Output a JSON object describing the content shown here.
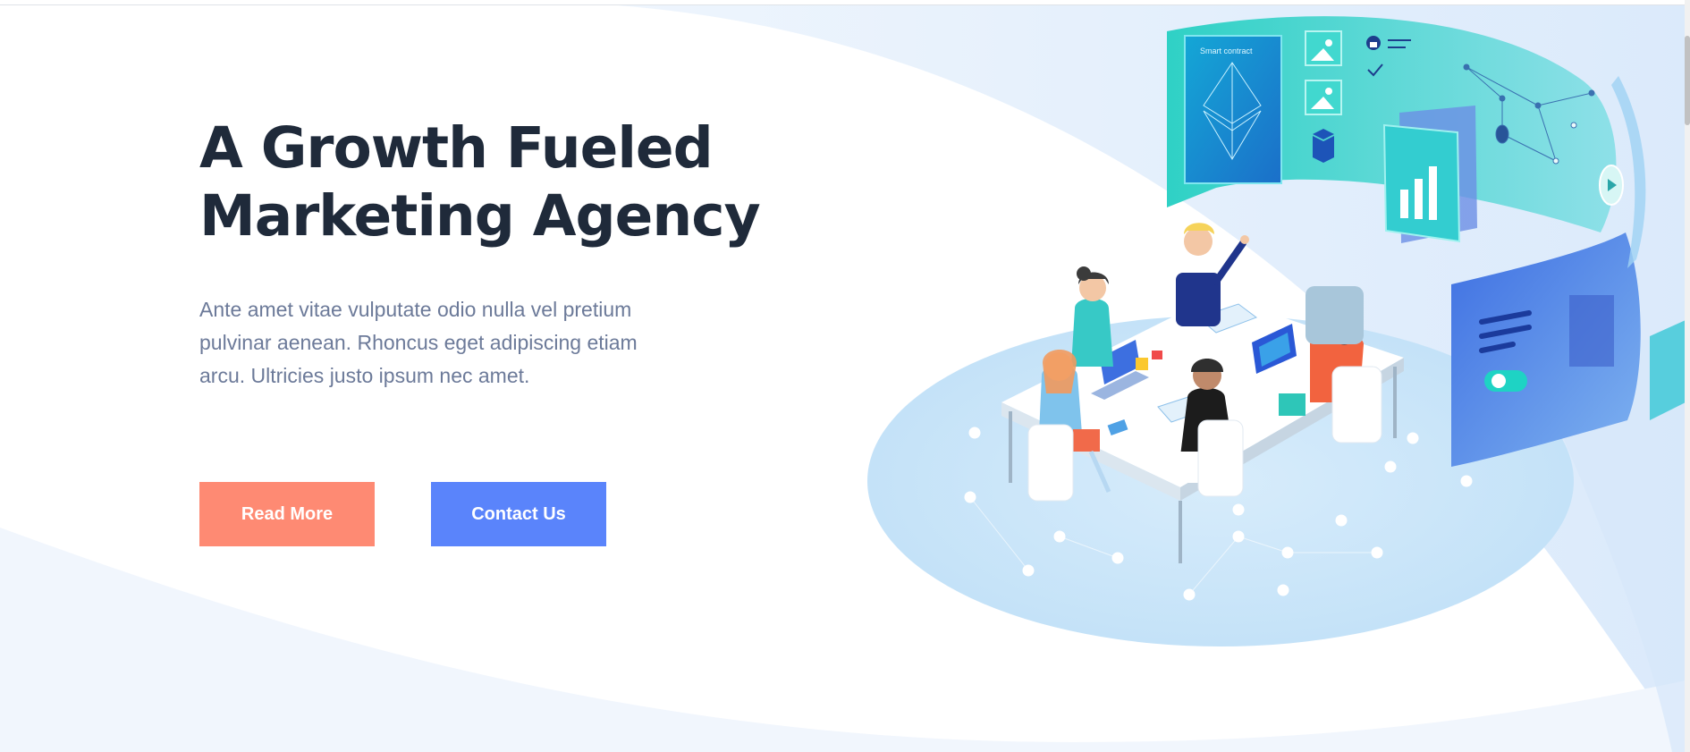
{
  "hero": {
    "title_line1": "A Growth Fueled",
    "title_line2": "Marketing Agency",
    "description_line1": "Ante amet vitae vulputate odio nulla vel pretium",
    "description_line2": "pulvinar aenean. Rhoncus eget adipiscing etiam",
    "description_line3": "arcu. Ultricies justo ipsum nec amet.",
    "read_more_label": "Read More",
    "contact_label": "Contact Us"
  },
  "illustration": {
    "panel_caption": "Smart contract",
    "icons": [
      "ethereum-icon",
      "image-icon",
      "lock-icon",
      "checkmark-icon",
      "cube-icon",
      "bar-chart-icon",
      "play-icon"
    ]
  },
  "colors": {
    "heading": "#1f2a3a",
    "body_text": "#6c7a99",
    "read_more_button": "#fe8a73",
    "contact_button": "#5a84fb",
    "teal_panel": "#3fd0c9",
    "blue_panel": "#4c7ee6",
    "background_wave": "#eaf3fd"
  }
}
